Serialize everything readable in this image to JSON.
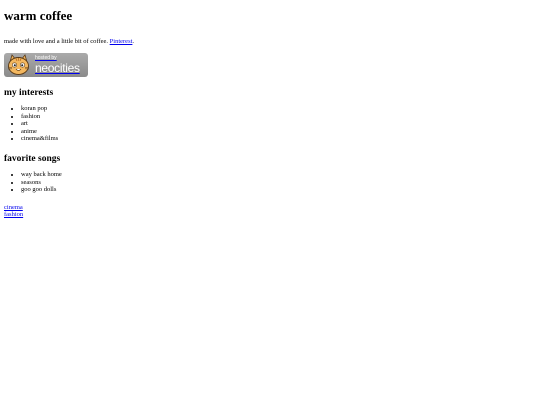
{
  "header": {
    "title": "warm coffee"
  },
  "intro": {
    "text": "made with love and a little bit of coffee.",
    "link_label": "Pinterest",
    "after_link": "."
  },
  "badge": {
    "small_text": "hosted by",
    "big_text": "neocities"
  },
  "interests": {
    "heading": "my interests",
    "items": [
      "koran pop",
      "fashion",
      "art",
      "anime",
      "cinema&films"
    ]
  },
  "songs": {
    "heading": "favorite songs",
    "items": [
      "way back home",
      "seasons",
      "goo goo dolls"
    ]
  },
  "links": {
    "items": [
      "cinema",
      "fashion"
    ]
  }
}
